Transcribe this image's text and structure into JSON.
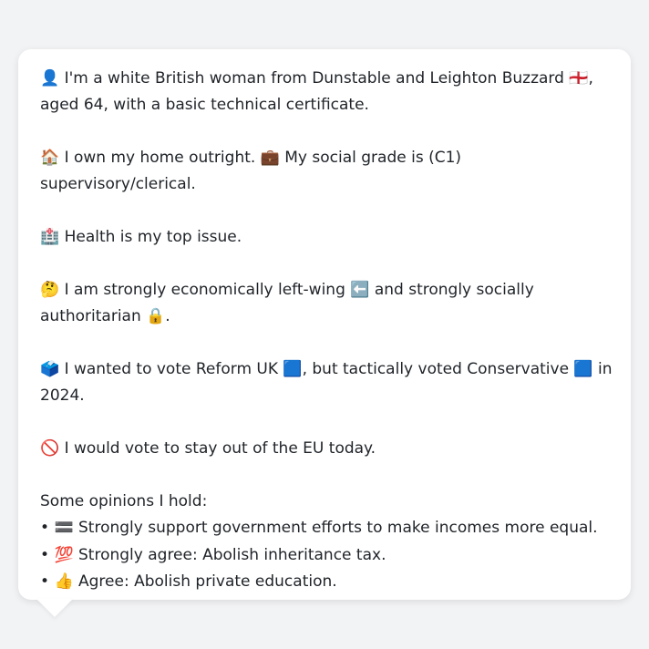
{
  "paragraphs": [
    "👤 I'm a white British woman from Dunstable and Leighton Buzzard 🏴󠁧󠁢󠁥󠁮󠁧󠁿, aged 64, with a basic technical certificate.",
    "🏠 I own my home outright. 💼 My social grade is (C1) supervisory/clerical.",
    "🏥 Health is my top issue.",
    "🤔 I am strongly economically left-wing ⬅️ and strongly socially authoritarian 🔒.",
    "🗳️ I wanted to vote Reform UK 🟦, but tactically voted Conservative 🟦 in 2024.",
    "🚫 I would vote to stay out of the EU today."
  ],
  "opinions_title": "Some opinions I hold:",
  "opinions": [
    "🟰 Strongly support government efforts to make incomes more equal.",
    "💯 Strongly agree: Abolish inheritance tax.",
    "👍 Agree: Abolish private education."
  ],
  "colors": {
    "background": "#f2f3f5",
    "card": "#ffffff",
    "text": "#1f2328"
  }
}
